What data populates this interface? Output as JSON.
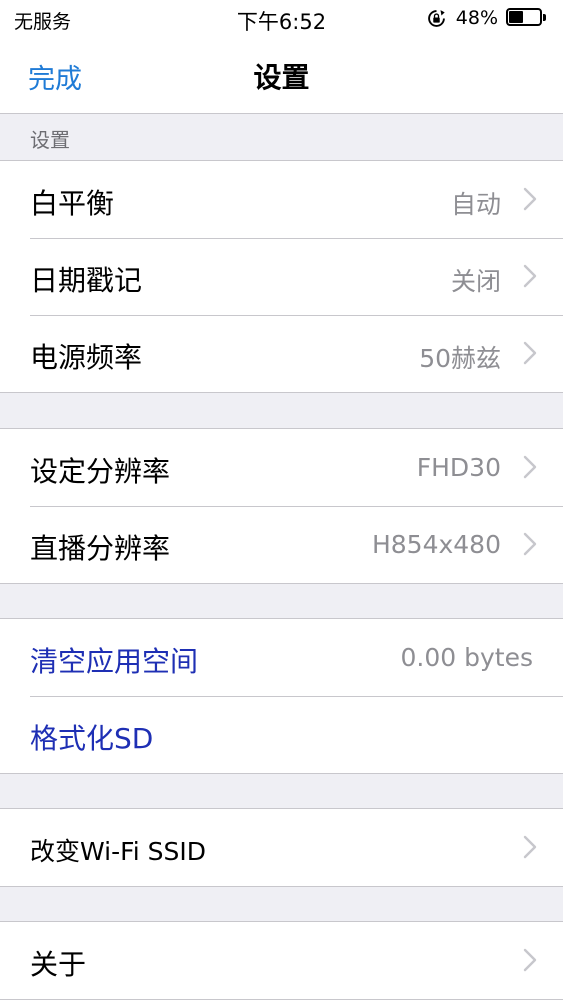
{
  "status_bar": {
    "carrier": "无服务",
    "time": "下午6:52",
    "battery_percent": "48%",
    "battery_level": 0.48,
    "orientation_lock_icon": "orientation-lock-icon",
    "battery_icon": "battery-icon"
  },
  "nav": {
    "done_label": "完成",
    "title": "设置"
  },
  "section_header": "设置",
  "groups": [
    {
      "rows": [
        {
          "label": "白平衡",
          "value": "自动",
          "chevron": true
        },
        {
          "label": "日期戳记",
          "value": "关闭",
          "chevron": true
        },
        {
          "label": "电源频率",
          "value": "50赫兹",
          "chevron": true
        }
      ]
    },
    {
      "rows": [
        {
          "label": "设定分辨率",
          "value": "FHD30",
          "chevron": true
        },
        {
          "label": "直播分辨率",
          "value": "H854x480",
          "chevron": true
        }
      ]
    },
    {
      "rows": [
        {
          "label": "清空应用空间",
          "value": "0.00 bytes",
          "chevron": false
        },
        {
          "label": "格式化SD",
          "value": "",
          "chevron": false
        }
      ]
    },
    {
      "rows": [
        {
          "label": "改变Wi-Fi SSID",
          "value": "",
          "chevron": true
        }
      ]
    },
    {
      "rows": [
        {
          "label": "关于",
          "value": "",
          "chevron": true
        }
      ]
    }
  ],
  "colors": {
    "nav_accent": "#1f7bd6",
    "action_text": "#1e2fb4",
    "secondary_text": "#8e8e93",
    "group_background": "#efeff4"
  }
}
